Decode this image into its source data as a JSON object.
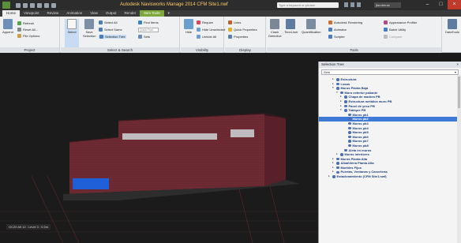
{
  "titlebar": {
    "title": "Autodesk Navisworks Manage 2014   CFM Site1.nwf",
    "search_placeholder": "Type a keyword or phrase",
    "user": "jfaroberas"
  },
  "tabs": [
    {
      "label": "Home",
      "state": "active"
    },
    {
      "label": "Viewpoint",
      "state": ""
    },
    {
      "label": "Review",
      "state": ""
    },
    {
      "label": "Animation",
      "state": ""
    },
    {
      "label": "View",
      "state": ""
    },
    {
      "label": "Output",
      "state": ""
    },
    {
      "label": "Render",
      "state": ""
    },
    {
      "label": "Item Tools",
      "state": "ctx"
    }
  ],
  "ribbon": {
    "project": {
      "label": "Project",
      "append": "Append",
      "refresh": "Refresh",
      "reset_all": "Reset All...",
      "file_options": "File Options"
    },
    "select_search": {
      "label": "Select & Search",
      "select": "Select",
      "save_selection": "Save Selection",
      "select_all": "Select All",
      "select_same": "Select Same",
      "selection_tree": "Selection Tree",
      "find_items": "Find Items",
      "quick_find": "Quick Find",
      "sets": "Sets"
    },
    "visibility": {
      "label": "Visibility",
      "hide": "Hide",
      "require": "Require",
      "hide_unselected": "Hide Unselected",
      "unhide_all": "Unhide All"
    },
    "display": {
      "label": "Display",
      "links": "Links",
      "quick_properties": "Quick Properties",
      "properties": "Properties"
    },
    "tools": {
      "label": "Tools",
      "clash_detective": "Clash Detective",
      "timeliner": "TimeLiner",
      "quantification": "Quantification",
      "autodesk_rendering": "Autodesk Rendering",
      "animator": "Animator",
      "scripter": "Scripter",
      "appearance_profiler": "Appearance Profiler",
      "batch_utility": "Batch Utility",
      "compare": "Compare",
      "datatools": "DataTools"
    }
  },
  "viewport": {
    "status": "GC20 Alt 12 : Level 3 : 0.5m"
  },
  "selection_tree": {
    "title": "Selection Tree",
    "mode": "Sets",
    "items": [
      {
        "label": "Estructura",
        "indent": 0,
        "toggle": "+",
        "hl": false
      },
      {
        "label": "Losas",
        "indent": 0,
        "toggle": "+",
        "hl": false
      },
      {
        "label": "Muros Planta Baja",
        "indent": 0,
        "toggle": "-",
        "hl": false
      },
      {
        "label": "Muro exterior paliante",
        "indent": 1,
        "toggle": "-",
        "hl": false
      },
      {
        "label": "Chapa de madera PB",
        "indent": 2,
        "toggle": "+",
        "hl": false
      },
      {
        "label": "Estructura metálica muro PB",
        "indent": 2,
        "toggle": "+",
        "hl": false
      },
      {
        "label": "Panel de yeso PB",
        "indent": 2,
        "toggle": "+",
        "hl": false
      },
      {
        "label": "Tabique PB",
        "indent": 2,
        "toggle": "-",
        "hl": false
      },
      {
        "label": "Muros pb1",
        "indent": 3,
        "toggle": "",
        "hl": false
      },
      {
        "label": "Muros pb2",
        "indent": 3,
        "toggle": "",
        "hl": true
      },
      {
        "label": "Muros pb3",
        "indent": 3,
        "toggle": "",
        "hl": false
      },
      {
        "label": "Muros pb4",
        "indent": 3,
        "toggle": "",
        "hl": false
      },
      {
        "label": "Muros pb5",
        "indent": 3,
        "toggle": "",
        "hl": false
      },
      {
        "label": "Muros pb6",
        "indent": 3,
        "toggle": "",
        "hl": false
      },
      {
        "label": "Muros pb7",
        "indent": 3,
        "toggle": "",
        "hl": false
      },
      {
        "label": "Muros pb8",
        "indent": 3,
        "toggle": "",
        "hl": false
      },
      {
        "label": "Aleta en muros",
        "indent": 2,
        "toggle": "",
        "hl": false
      },
      {
        "label": "Muros interiores",
        "indent": 1,
        "toggle": "+",
        "hl": false
      },
      {
        "label": "Muros Planta Alta",
        "indent": 0,
        "toggle": "+",
        "hl": false
      },
      {
        "label": "Albañilería Planta Alta",
        "indent": 0,
        "toggle": "+",
        "hl": false
      },
      {
        "label": "Muebles Fijos",
        "indent": 0,
        "toggle": "+",
        "hl": false
      },
      {
        "label": "Puertas, Ventanas y Cancelería",
        "indent": 0,
        "toggle": "+",
        "hl": false
      },
      {
        "label": "Estacionamiento (CFM Site1.nwf)",
        "indent": -1,
        "toggle": "+",
        "hl": false
      }
    ]
  },
  "colors": {
    "accent": "#7ea83c",
    "selection": "#3f79d8",
    "building": "#6e2a33"
  }
}
